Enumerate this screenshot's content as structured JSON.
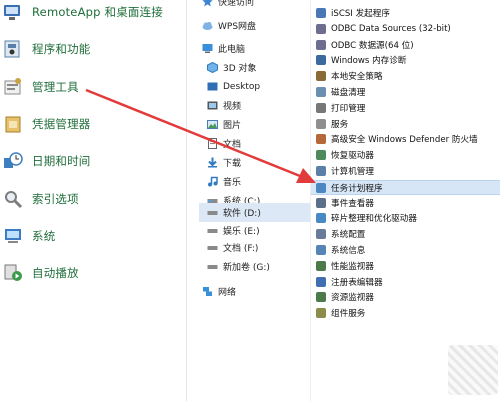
{
  "control_panel": {
    "items": [
      {
        "label": "RemoteApp 和桌面连接",
        "icon": "remoteapp-icon",
        "color": "#3b6fb5"
      },
      {
        "label": "程序和功能",
        "icon": "programs-icon",
        "color": "#5a7fa8"
      },
      {
        "label": "管理工具",
        "icon": "admin-tools-icon",
        "color": "#8a8a8a"
      },
      {
        "label": "凭据管理器",
        "icon": "credential-icon",
        "color": "#c79a3a"
      },
      {
        "label": "日期和时间",
        "icon": "clock-icon",
        "color": "#3d7fbf"
      },
      {
        "label": "索引选项",
        "icon": "index-search-icon",
        "color": "#7d7d7d"
      },
      {
        "label": "系统",
        "icon": "computer-icon",
        "color": "#3b7cc4"
      },
      {
        "label": "自动播放",
        "icon": "autoplay-icon",
        "color": "#3a9a4a"
      }
    ]
  },
  "nav": {
    "items": [
      {
        "label": "快速访问",
        "icon": "star-icon"
      },
      {
        "label": "WPS网盘",
        "icon": "cloud-icon"
      },
      {
        "label": "此电脑",
        "icon": "this-pc-icon"
      },
      {
        "label": "3D 对象",
        "icon": "3d-objects-icon"
      },
      {
        "label": "Desktop",
        "icon": "desktop-icon"
      },
      {
        "label": "视频",
        "icon": "video-icon"
      },
      {
        "label": "图片",
        "icon": "pictures-icon"
      },
      {
        "label": "文档",
        "icon": "documents-icon"
      },
      {
        "label": "下载",
        "icon": "download-icon"
      },
      {
        "label": "音乐",
        "icon": "music-icon"
      },
      {
        "label": "系统 (C:)",
        "icon": "drive-icon"
      },
      {
        "label": "软件 (D:)",
        "icon": "drive-icon"
      },
      {
        "label": "娱乐 (E:)",
        "icon": "drive-icon"
      },
      {
        "label": "文档 (F:)",
        "icon": "drive-icon"
      },
      {
        "label": "新加卷 (G:)",
        "icon": "drive-icon"
      },
      {
        "label": "网络",
        "icon": "network-icon"
      }
    ]
  },
  "tools": {
    "items": [
      {
        "label": "iSCSI 发起程序",
        "icon": "iscsi-icon",
        "color": "#4a78b5"
      },
      {
        "label": "ODBC Data Sources (32-bit)",
        "icon": "odbc-icon",
        "color": "#6d6d8f"
      },
      {
        "label": "ODBC 数据源(64 位)",
        "icon": "odbc-icon",
        "color": "#6d6d8f"
      },
      {
        "label": "Windows 内存诊断",
        "icon": "memory-icon",
        "color": "#3c6a9e"
      },
      {
        "label": "本地安全策略",
        "icon": "security-policy-icon",
        "color": "#8b6a3a"
      },
      {
        "label": "磁盘清理",
        "icon": "disk-cleanup-icon",
        "color": "#6b8fb0"
      },
      {
        "label": "打印管理",
        "icon": "print-icon",
        "color": "#777777"
      },
      {
        "label": "服务",
        "icon": "services-icon",
        "color": "#8f8f8f"
      },
      {
        "label": "高级安全 Windows Defender 防火墙",
        "icon": "firewall-icon",
        "color": "#b5683a"
      },
      {
        "label": "恢复驱动器",
        "icon": "recovery-icon",
        "color": "#4f8a5f"
      },
      {
        "label": "计算机管理",
        "icon": "computer-mgmt-icon",
        "color": "#5a7fa8"
      },
      {
        "label": "任务计划程序",
        "icon": "task-scheduler-icon",
        "color": "#4d87c2"
      },
      {
        "label": "事件查看器",
        "icon": "event-viewer-icon",
        "color": "#5c6f8a"
      },
      {
        "label": "碎片整理和优化驱动器",
        "icon": "defrag-icon",
        "color": "#4a8ac4"
      },
      {
        "label": "系统配置",
        "icon": "system-config-icon",
        "color": "#6a7a9a"
      },
      {
        "label": "系统信息",
        "icon": "system-info-icon",
        "color": "#5585b5"
      },
      {
        "label": "性能监视器",
        "icon": "performance-icon",
        "color": "#4b7b4b"
      },
      {
        "label": "注册表编辑器",
        "icon": "registry-icon",
        "color": "#3f6fb0"
      },
      {
        "label": "资源监视器",
        "icon": "resource-monitor-icon",
        "color": "#4b7b4b"
      },
      {
        "label": "组件服务",
        "icon": "component-services-icon",
        "color": "#8b8b4a"
      }
    ],
    "selected_index": 11
  },
  "annotation": {
    "arrow_color": "#e23b3b"
  }
}
